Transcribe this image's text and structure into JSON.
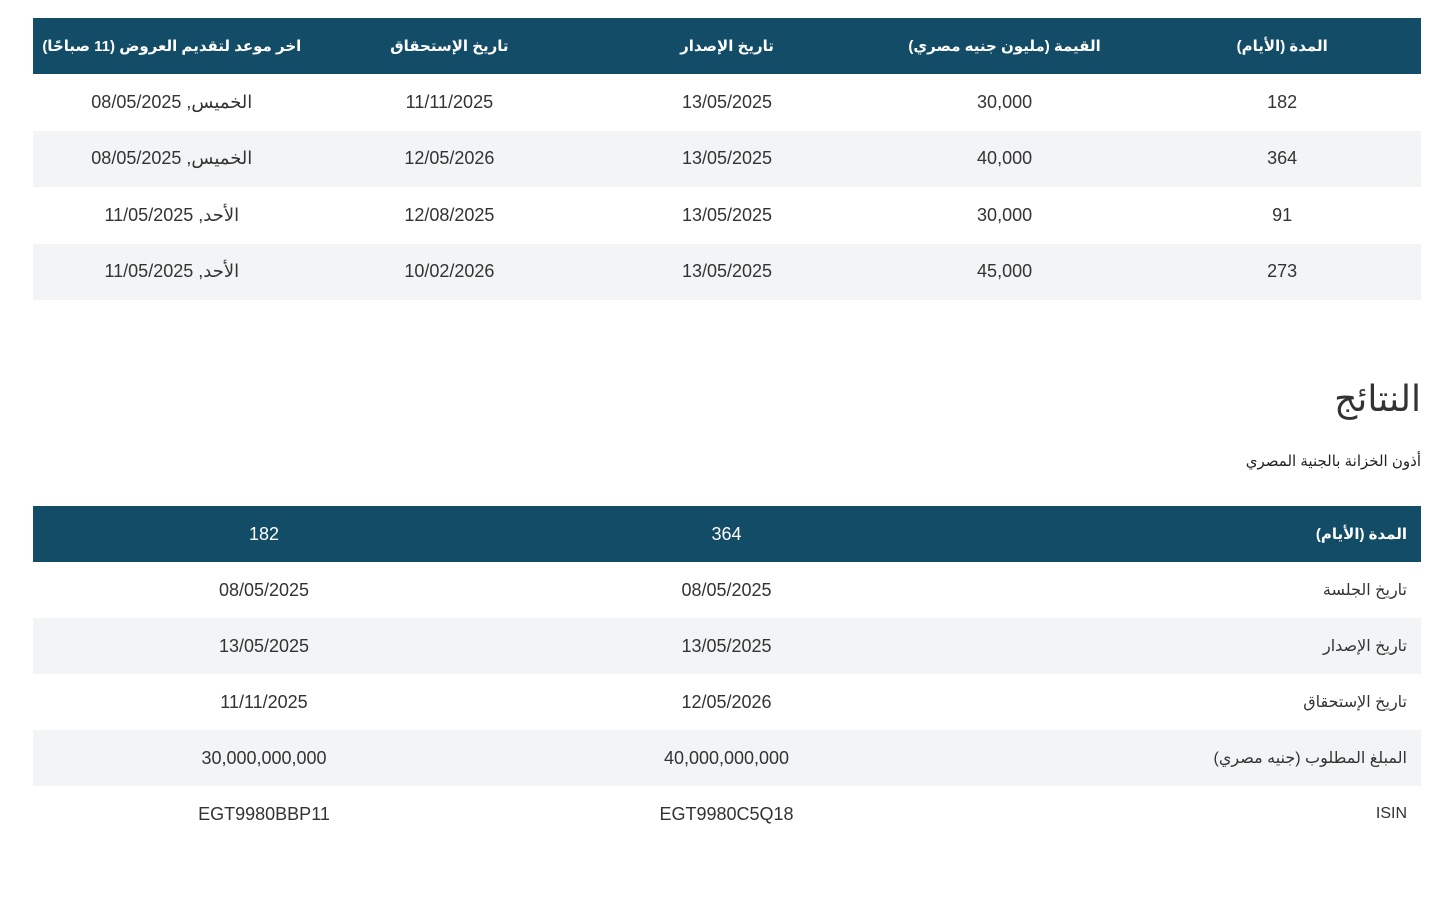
{
  "table1": {
    "headers": [
      "المدة (الأيام)",
      "القيمة (مليون جنيه مصري)",
      "تاريخ الإصدار",
      "تاريخ الإستحقاق",
      "اخر موعد لتقديم العروض (11 صباحًا)"
    ],
    "rows": [
      {
        "duration": "182",
        "value": "30,000",
        "issue_date": "13/05/2025",
        "maturity_date": "11/11/2025",
        "deadline_day": "الخميس",
        "deadline_date": "08/05/2025"
      },
      {
        "duration": "364",
        "value": "40,000",
        "issue_date": "13/05/2025",
        "maturity_date": "12/05/2026",
        "deadline_day": "الخميس",
        "deadline_date": "08/05/2025"
      },
      {
        "duration": "91",
        "value": "30,000",
        "issue_date": "13/05/2025",
        "maturity_date": "12/08/2025",
        "deadline_day": "الأحد",
        "deadline_date": "11/05/2025"
      },
      {
        "duration": "273",
        "value": "45,000",
        "issue_date": "13/05/2025",
        "maturity_date": "10/02/2026",
        "deadline_day": "الأحد",
        "deadline_date": "11/05/2025"
      }
    ]
  },
  "results": {
    "title": "النتائج",
    "subtitle": "أذون الخزانة بالجنية المصري",
    "header_label": "المدة (الأيام)",
    "columns": [
      "364",
      "182"
    ],
    "rows": [
      {
        "label": "تاريخ الجلسة",
        "values": [
          "08/05/2025",
          "08/05/2025"
        ]
      },
      {
        "label": "تاريخ الإصدار",
        "values": [
          "13/05/2025",
          "13/05/2025"
        ]
      },
      {
        "label": "تاريخ الإستحقاق",
        "values": [
          "12/05/2026",
          "11/11/2025"
        ]
      },
      {
        "label": "المبلغ المطلوب (جنيه مصري)",
        "values": [
          "40,000,000,000",
          "30,000,000,000"
        ]
      },
      {
        "label": "ISIN",
        "values": [
          "EGT9980C5Q18",
          "EGT9980BBP11"
        ]
      }
    ]
  },
  "colors": {
    "header_bg": "#124c66",
    "alt_row_bg": "#f3f4f5",
    "text": "#333333"
  }
}
